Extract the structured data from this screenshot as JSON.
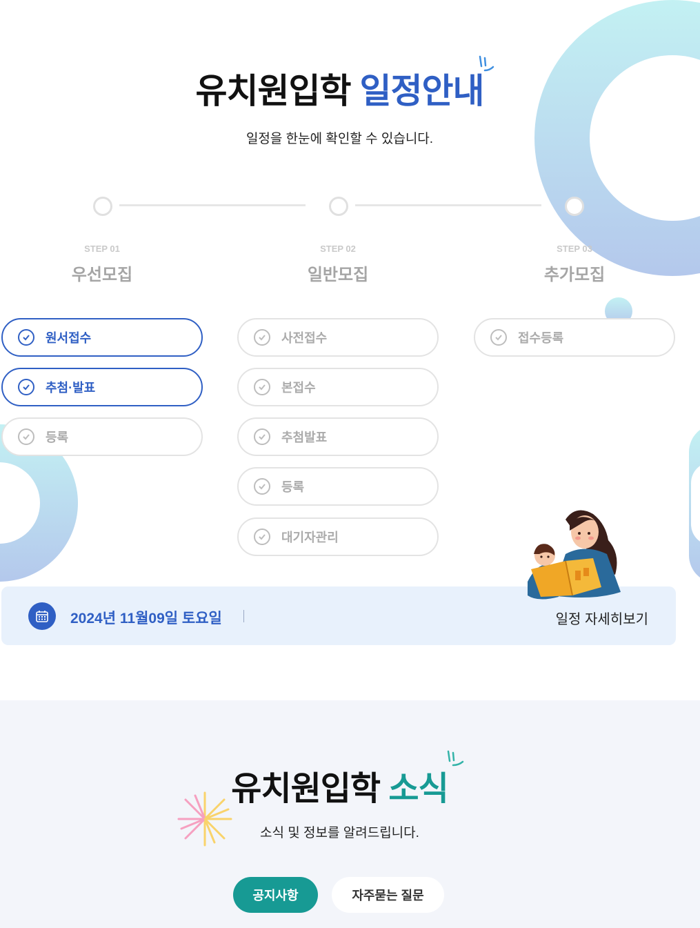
{
  "schedule": {
    "title_main": "유치원입학",
    "title_accent": "일정안내",
    "subtitle": "일정을 한눈에 확인할 수 있습니다.",
    "steps": [
      {
        "num": "STEP 01",
        "name": "우선모집"
      },
      {
        "num": "STEP 02",
        "name": "일반모집"
      },
      {
        "num": "STEP 03",
        "name": "추가모집"
      }
    ],
    "columns": [
      [
        {
          "label": "원서접수",
          "active": true
        },
        {
          "label": "추첨·발표",
          "active": true
        },
        {
          "label": "등록",
          "active": false
        }
      ],
      [
        {
          "label": "사전접수",
          "active": false
        },
        {
          "label": "본접수",
          "active": false
        },
        {
          "label": "추첨발표",
          "active": false
        },
        {
          "label": "등록",
          "active": false
        },
        {
          "label": "대기자관리",
          "active": false
        }
      ],
      [
        {
          "label": "접수등록",
          "active": false
        }
      ]
    ],
    "date": "2024년 11월09일 토요일",
    "detail_link": "일정 자세히보기"
  },
  "news": {
    "title_main": "유치원입학",
    "title_accent": "소식",
    "subtitle": "소식 및 정보를 알려드립니다.",
    "tabs": [
      {
        "label": "공지사항",
        "active": true
      },
      {
        "label": "자주묻는 질문",
        "active": false
      }
    ]
  },
  "colors": {
    "primary_blue": "#2f5fc4",
    "teal": "#179a94",
    "date_bar_bg": "#e8f1fc",
    "news_bg": "#f3f5fa"
  },
  "icons": [
    "check-circle-icon",
    "calendar-icon",
    "sparkle-icon"
  ]
}
